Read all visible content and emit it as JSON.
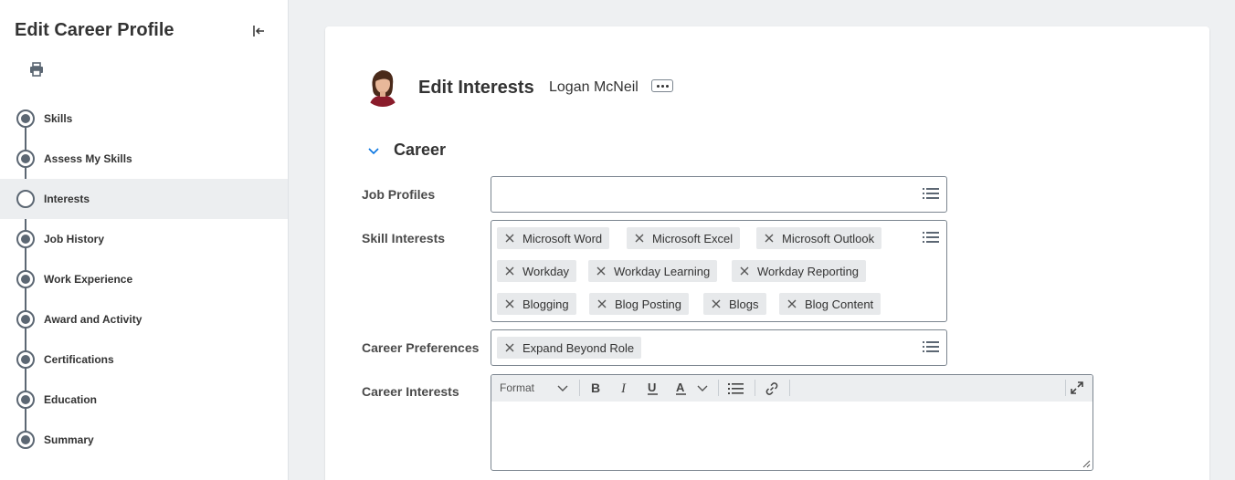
{
  "sidebar": {
    "title": "Edit Career Profile",
    "steps": [
      {
        "label": "Skills",
        "state": "filled"
      },
      {
        "label": "Assess My Skills",
        "state": "filled"
      },
      {
        "label": "Interests",
        "state": "current"
      },
      {
        "label": "Job History",
        "state": "filled"
      },
      {
        "label": "Work Experience",
        "state": "filled"
      },
      {
        "label": "Award and Activity",
        "state": "filled"
      },
      {
        "label": "Certifications",
        "state": "filled"
      },
      {
        "label": "Education",
        "state": "filled"
      },
      {
        "label": "Summary",
        "state": "filled"
      }
    ]
  },
  "header": {
    "title": "Edit Interests",
    "person_name": "Logan McNeil"
  },
  "section": {
    "title": "Career",
    "fields": {
      "job_profiles": {
        "label": "Job Profiles",
        "value": ""
      },
      "skill_interests": {
        "label": "Skill Interests",
        "tags": [
          "Microsoft Word",
          "Microsoft Excel",
          "Microsoft Outlook",
          "Workday",
          "Workday Learning",
          "Workday Reporting",
          "Blogging",
          "Blog Posting",
          "Blogs",
          "Blog Content"
        ]
      },
      "career_preferences": {
        "label": "Career Preferences",
        "tags": [
          "Expand Beyond Role"
        ]
      },
      "career_interests": {
        "label": "Career Interests",
        "format_label": "Format",
        "value": ""
      }
    }
  },
  "icons": {
    "collapse": "collapse-left-icon",
    "print": "printer-icon",
    "more": "more-dots-icon",
    "chevron": "chevron-down-icon",
    "list": "list-icon",
    "remove": "close-icon",
    "bold": "bold-icon",
    "italic": "italic-icon",
    "underline": "underline-icon",
    "text_color": "text-color-icon",
    "bullet_list": "bullet-list-icon",
    "link": "link-icon",
    "expand": "expand-icon"
  },
  "colors": {
    "accent_blue": "#0875e1",
    "step_gray": "#5c6773",
    "tag_bg": "#e7e9eb",
    "page_bg": "#eef0f2"
  }
}
